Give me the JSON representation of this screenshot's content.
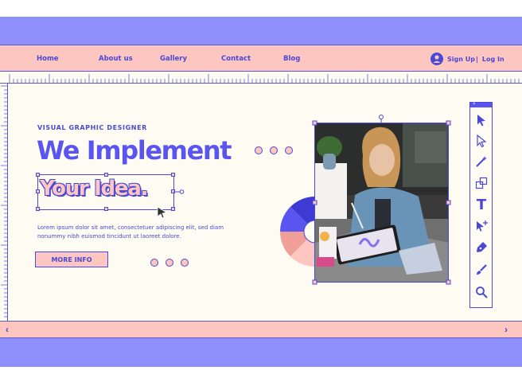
{
  "nav": {
    "home": "Home",
    "about": "About us",
    "gallery": "Gallery",
    "contact": "Contact",
    "blog": "Blog",
    "signup": "Sign Up",
    "separator": "|",
    "login": "Log In"
  },
  "hero": {
    "eyebrow": "VISUAL GRAPHIC DESIGNER",
    "headline": "We Implement",
    "highlight": "Your Idea.",
    "body_line1": "Lorem ipsum dolor sit amet, consectetuer adipiscing elit, sed diam",
    "body_line2": "nonummy nibh euismod tincidunt ut laoreet dolore.",
    "cta": "MORE INFO"
  },
  "nav_arrows": {
    "prev": "‹",
    "next": "›"
  },
  "toolbox": {
    "tools": [
      "select-arrow",
      "direct-select-arrow",
      "magic-wand",
      "transform",
      "text",
      "pen-add",
      "pen",
      "brush",
      "zoom"
    ],
    "text_tool_glyph": "T"
  },
  "colors": {
    "frame": "#8f8ffb",
    "accent": "#5a55f0",
    "ink": "#4a48d6",
    "pink": "#fdc6c0",
    "paper": "#fefcf2"
  }
}
